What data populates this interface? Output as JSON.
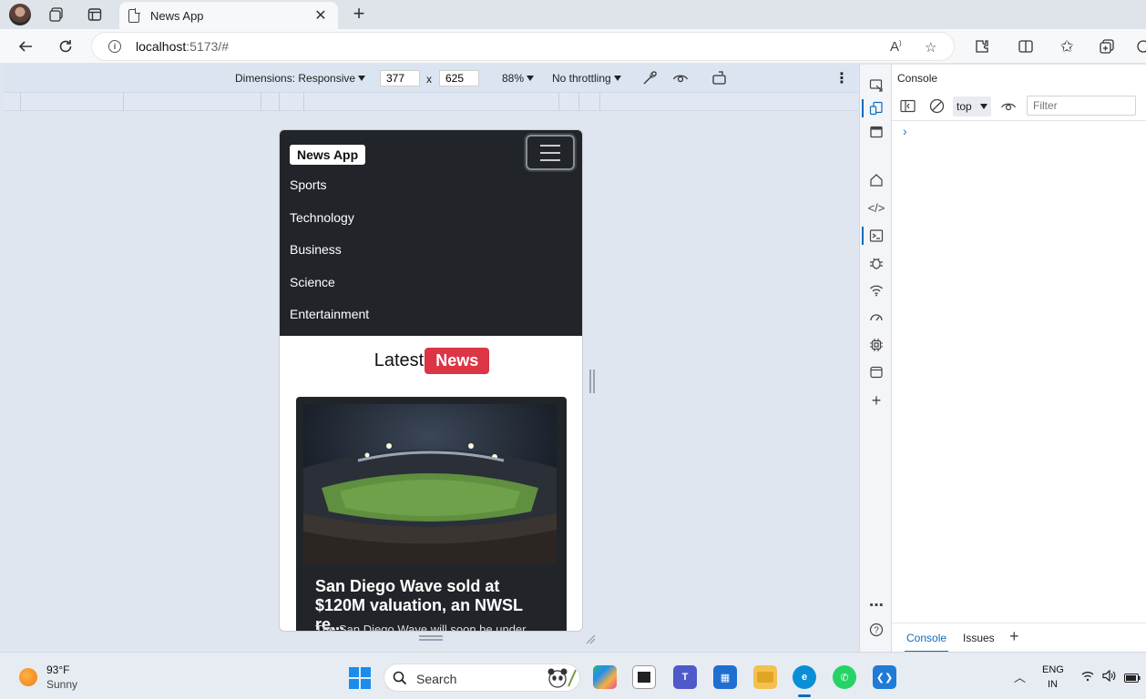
{
  "browser": {
    "tab_title": "News App",
    "url_host": "localhost",
    "url_rest": ":5173/#"
  },
  "device_toolbar": {
    "dimensions_label": "Dimensions: Responsive",
    "width_value": "377",
    "height_value": "625",
    "times": "x",
    "zoom": "88%",
    "throttling": "No throttling"
  },
  "app": {
    "brand": "News App",
    "nav_links": [
      "Sports",
      "Technology",
      "Business",
      "Science",
      "Entertainment"
    ],
    "headline_prefix": "Latest",
    "headline_badge": "News",
    "card": {
      "title": "San Diego Wave sold at $120M valuation, an NWSL re...",
      "text": "The San Diego Wave will soon be under..."
    }
  },
  "devtools": {
    "panel_title": "Console",
    "context": "top",
    "filter_placeholder": "Filter",
    "prompt": "›",
    "drawer_tabs": [
      "Console",
      "Issues"
    ],
    "add_tab": "+"
  },
  "taskbar": {
    "temperature": "93°F",
    "condition": "Sunny",
    "search_label": "Search",
    "lang": "ENG",
    "region": "IN"
  },
  "colors": {
    "navbar_bg": "#212529",
    "news_badge": "#dc3545",
    "accent": "#0f6cbd"
  }
}
